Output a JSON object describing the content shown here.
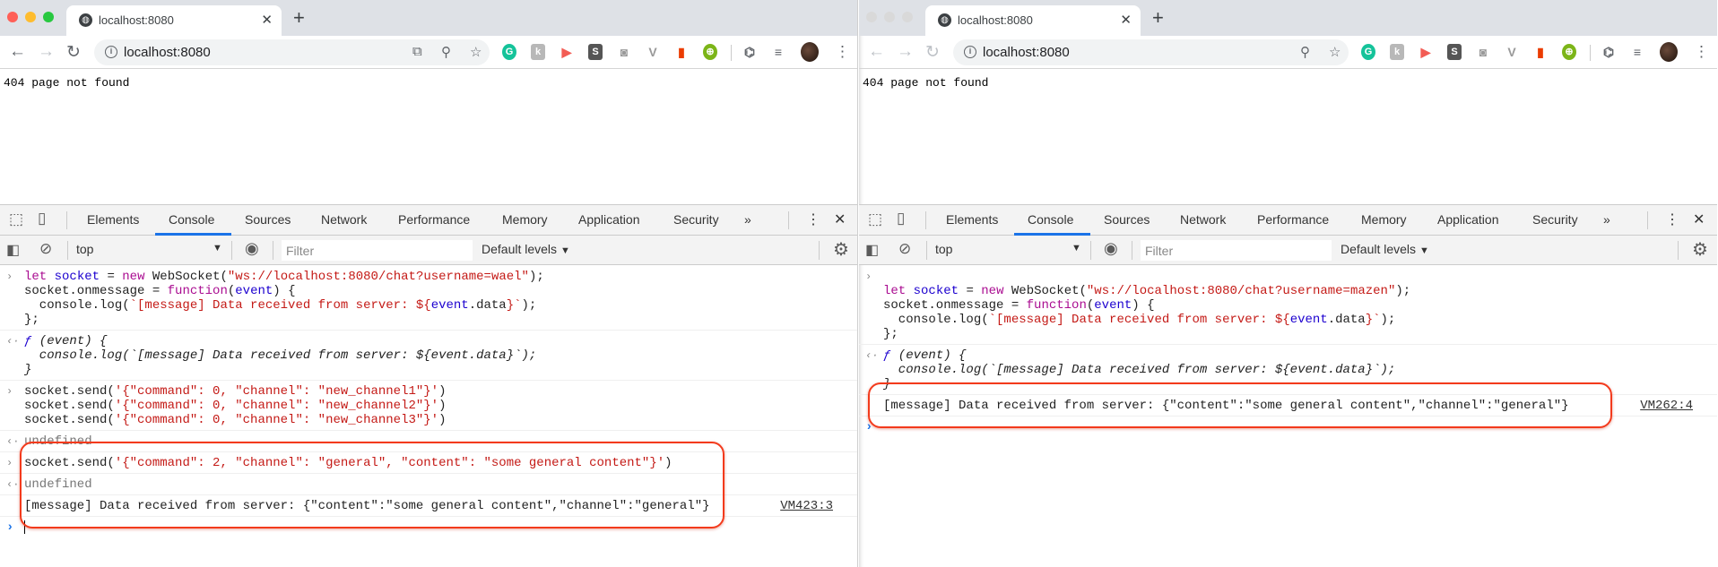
{
  "windows": [
    {
      "active": true,
      "tab_title": "localhost:8080",
      "url": "localhost:8080",
      "page_text": "404 page not found",
      "devtools_tabs": [
        "Elements",
        "Console",
        "Sources",
        "Network",
        "Performance",
        "Memory",
        "Application",
        "Security"
      ],
      "active_tab": "Console",
      "context": "top",
      "filter_placeholder": "Filter",
      "levels": "Default levels",
      "entries": [
        {
          "kind": "input",
          "lines": [
            [
              [
                "k",
                "let"
              ],
              [
                "p",
                " "
              ],
              [
                "v",
                "socket"
              ],
              [
                "p",
                " = "
              ],
              [
                "k",
                "new"
              ],
              [
                "p",
                " WebSocket("
              ],
              [
                "s",
                "\"ws://localhost:8080/chat?username=wael\""
              ],
              [
                "p",
                ");"
              ]
            ],
            [
              [
                "p",
                "socket.onmessage = "
              ],
              [
                "k",
                "function"
              ],
              [
                "p",
                "("
              ],
              [
                "v",
                "event"
              ],
              [
                "p",
                ") {"
              ]
            ],
            [
              [
                "p",
                "  console.log("
              ],
              [
                "s",
                "`[message] Data received from server: ${"
              ],
              [
                "v",
                "event"
              ],
              [
                "p",
                ".data"
              ],
              [
                "s",
                "}`"
              ],
              [
                "p",
                ");"
              ]
            ],
            [
              [
                "p",
                "};"
              ]
            ]
          ]
        },
        {
          "kind": "output",
          "lines": [
            [
              [
                "v",
                "ƒ"
              ],
              [
                "p",
                " (event) {"
              ]
            ],
            [
              [
                "p",
                "  console.log(`[message] Data received from server: ${event.data}`);"
              ]
            ],
            [
              [
                "p",
                "}"
              ]
            ]
          ]
        },
        {
          "kind": "input",
          "lines": [
            [
              [
                "p",
                "socket.send("
              ],
              [
                "s",
                "'{\"command\": 0, \"channel\": \"new_channel1\"}'"
              ],
              [
                "p",
                ")"
              ]
            ],
            [
              [
                "p",
                "socket.send("
              ],
              [
                "s",
                "'{\"command\": 0, \"channel\": \"new_channel2\"}'"
              ],
              [
                "p",
                ")"
              ]
            ],
            [
              [
                "p",
                "socket.send("
              ],
              [
                "s",
                "'{\"command\": 0, \"channel\": \"new_channel3\"}'"
              ],
              [
                "p",
                ")"
              ]
            ]
          ]
        },
        {
          "kind": "result",
          "lines": [
            [
              [
                "g",
                "undefined"
              ]
            ]
          ]
        },
        {
          "kind": "input",
          "lines": [
            [
              [
                "p",
                "socket.send("
              ],
              [
                "s",
                "'{\"command\": 2, \"channel\": \"general\", \"content\": \"some general content\"}'"
              ],
              [
                "p",
                ")"
              ]
            ]
          ]
        },
        {
          "kind": "result",
          "lines": [
            [
              [
                "g",
                "undefined"
              ]
            ]
          ]
        },
        {
          "kind": "log",
          "source": "VM423:3",
          "lines": [
            [
              [
                "p",
                "[message] Data received from server: {\"content\":\"some general content\",\"channel\":\"general\"}"
              ]
            ]
          ]
        },
        {
          "kind": "prompt",
          "lines": []
        }
      ],
      "highlight_color": "#f33a1c"
    },
    {
      "active": false,
      "tab_title": "localhost:8080",
      "url": "localhost:8080",
      "page_text": "404 page not found",
      "devtools_tabs": [
        "Elements",
        "Console",
        "Sources",
        "Network",
        "Performance",
        "Memory",
        "Application",
        "Security"
      ],
      "active_tab": "Console",
      "context": "top",
      "filter_placeholder": "Filter",
      "levels": "Default levels",
      "entries": [
        {
          "kind": "input",
          "lines": [
            [],
            [
              [
                "k",
                "let"
              ],
              [
                "p",
                " "
              ],
              [
                "v",
                "socket"
              ],
              [
                "p",
                " = "
              ],
              [
                "k",
                "new"
              ],
              [
                "p",
                " WebSocket("
              ],
              [
                "s",
                "\"ws://localhost:8080/chat?username=mazen\""
              ],
              [
                "p",
                ");"
              ]
            ],
            [
              [
                "p",
                "socket.onmessage = "
              ],
              [
                "k",
                "function"
              ],
              [
                "p",
                "("
              ],
              [
                "v",
                "event"
              ],
              [
                "p",
                ") {"
              ]
            ],
            [
              [
                "p",
                "  console.log("
              ],
              [
                "s",
                "`[message] Data received from server: ${"
              ],
              [
                "v",
                "event"
              ],
              [
                "p",
                ".data"
              ],
              [
                "s",
                "}`"
              ],
              [
                "p",
                ");"
              ]
            ],
            [
              [
                "p",
                "};"
              ]
            ]
          ]
        },
        {
          "kind": "output",
          "lines": [
            [
              [
                "v",
                "ƒ"
              ],
              [
                "p",
                " (event) {"
              ]
            ],
            [
              [
                "p",
                "  console.log(`[message] Data received from server: ${event.data}`);"
              ]
            ],
            [
              [
                "p",
                "}"
              ]
            ]
          ]
        },
        {
          "kind": "log",
          "source": "VM262:4",
          "lines": [
            [
              [
                "p",
                "[message] Data received from server: {\"content\":\"some general content\",\"channel\":\"general\"}"
              ]
            ]
          ]
        },
        {
          "kind": "prompt",
          "lines": []
        }
      ],
      "highlight_color": "#f33a1c"
    }
  ],
  "icons": {
    "back": "arrow-left",
    "forward": "arrow-right",
    "reload": "reload",
    "info": "info",
    "extensions": [
      "grammarly",
      "k-extension",
      "play-extension",
      "s-extension",
      "camera",
      "vue-devtools",
      "office",
      "globe-green"
    ]
  }
}
